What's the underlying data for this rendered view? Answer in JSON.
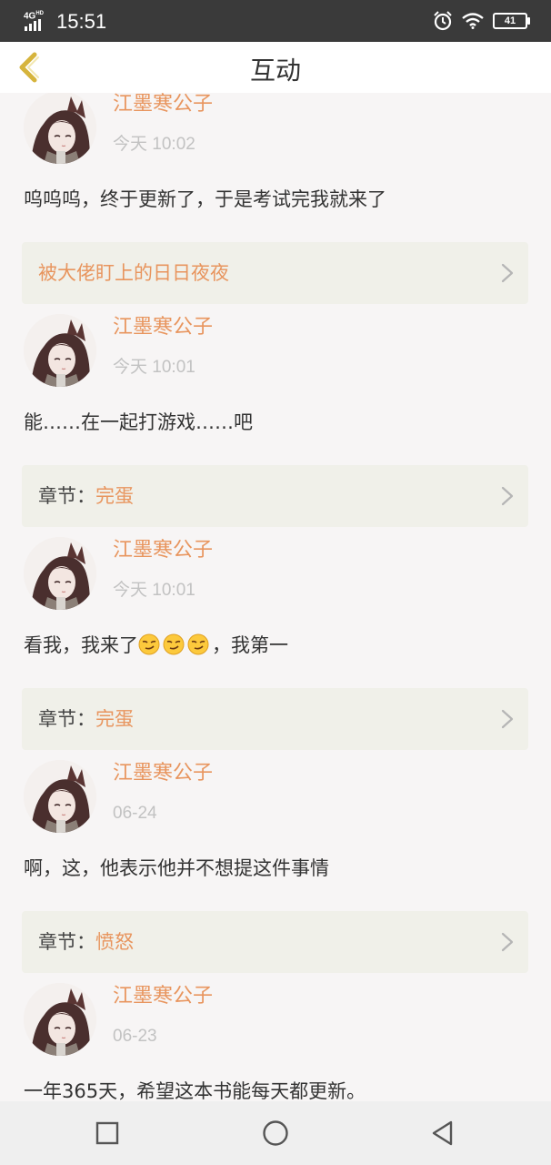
{
  "status_bar": {
    "network": "4G",
    "network_sup": "HD",
    "time": "15:51",
    "battery": "41",
    "icons": [
      "signal-icon",
      "alarm-icon",
      "wifi-icon",
      "battery-icon"
    ]
  },
  "header": {
    "title": "互动",
    "back_icon": "back-chevron-icon"
  },
  "colors": {
    "accent": "#e8955e",
    "muted": "#c2c2c2",
    "card_bg": "#f0f0e9",
    "page_bg": "#f7f5f5"
  },
  "comments": [
    {
      "user": "江墨寒公子",
      "time": "今天 10:02",
      "text": "呜呜呜，终于更新了，于是考试完我就来了",
      "link_prefix": "",
      "link_target": "被大佬盯上的日日夜夜"
    },
    {
      "user": "江墨寒公子",
      "time": "今天 10:01",
      "text": "能……在一起打游戏……吧",
      "link_prefix": "章节：",
      "link_target": "完蛋"
    },
    {
      "user": "江墨寒公子",
      "time": "今天 10:01",
      "text_before": "看我，我来了",
      "emoji": "smirk-emoji",
      "emoji_count": 3,
      "text_after": "，我第一",
      "link_prefix": "章节：",
      "link_target": "完蛋"
    },
    {
      "user": "江墨寒公子",
      "time": "06-24",
      "text": "啊，这，他表示他并不想提这件事情",
      "link_prefix": "章节：",
      "link_target": "愤怒"
    },
    {
      "user": "江墨寒公子",
      "time": "06-23",
      "text": "一年365天，希望这本书能每天都更新。"
    }
  ],
  "bottom_nav": {
    "icons": [
      "recent-apps-icon",
      "home-icon",
      "back-icon"
    ]
  }
}
